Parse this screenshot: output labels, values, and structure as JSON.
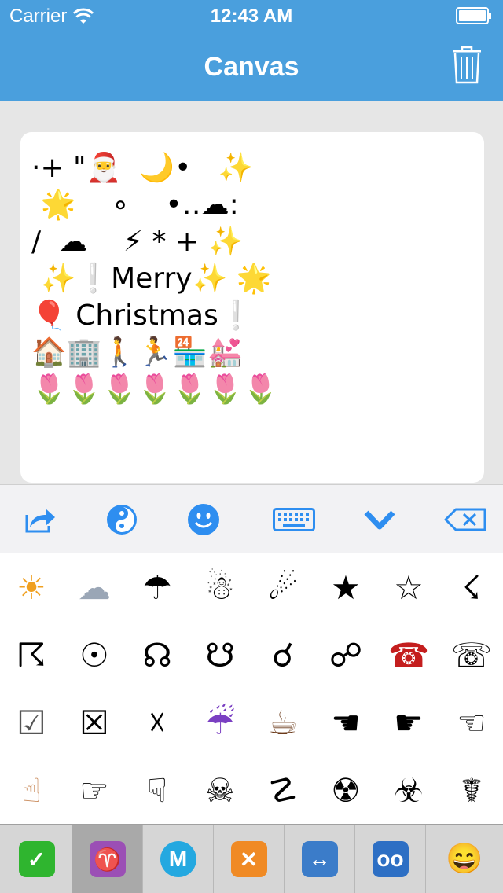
{
  "status_bar": {
    "carrier": "Carrier",
    "time": "12:43 AM"
  },
  "nav": {
    "title": "Canvas"
  },
  "canvas": {
    "lines": [
      "·+ \"🎅  🌙•   ✨",
      " 🌟    ∘    •‥☁:",
      "/  ☁    ⚡ * + ✨",
      " ✨❕Merry✨ 🌟",
      "🎈 Christmas❕",
      "🏠🏢🚶🏃🏪💒",
      "🌷🌷🌷🌷🌷🌷🌷"
    ]
  },
  "toolbar": {
    "items": [
      {
        "name": "share-icon"
      },
      {
        "name": "yin-yang-icon"
      },
      {
        "name": "smiley-icon"
      },
      {
        "name": "keyboard-icon"
      },
      {
        "name": "chevron-down-icon"
      },
      {
        "name": "backspace-icon"
      }
    ]
  },
  "symbols": [
    "☀",
    "☁",
    "☂",
    "☃",
    "☄",
    "★",
    "☆",
    "☇",
    "☈",
    "☉",
    "☊",
    "☋",
    "☌",
    "☍",
    "☎",
    "☏",
    "☑",
    "☒",
    "☓",
    "☔",
    "☕",
    "☚",
    "☛",
    "☜",
    "☝",
    "☞",
    "☟",
    "☠",
    "☡",
    "☢",
    "☣",
    "☤"
  ],
  "tabs": [
    {
      "name": "tab-check",
      "glyph": "✓",
      "color": "#2fb52f"
    },
    {
      "name": "tab-aries",
      "glyph": "♈",
      "color": "#9b4fb5"
    },
    {
      "name": "tab-metro",
      "glyph": "M",
      "color": "#24a8e0"
    },
    {
      "name": "tab-cross",
      "glyph": "✕",
      "color": "#f08a24"
    },
    {
      "name": "tab-arrows",
      "glyph": "↔",
      "color": "#3b7cc9"
    },
    {
      "name": "tab-voicemail",
      "glyph": "oo",
      "color": "#2d6fc4"
    },
    {
      "name": "tab-emoji",
      "glyph": "😄",
      "color": "#f5c12e"
    }
  ],
  "colors": {
    "header": "#4a9fdd",
    "accent": "#2e8ef0"
  }
}
